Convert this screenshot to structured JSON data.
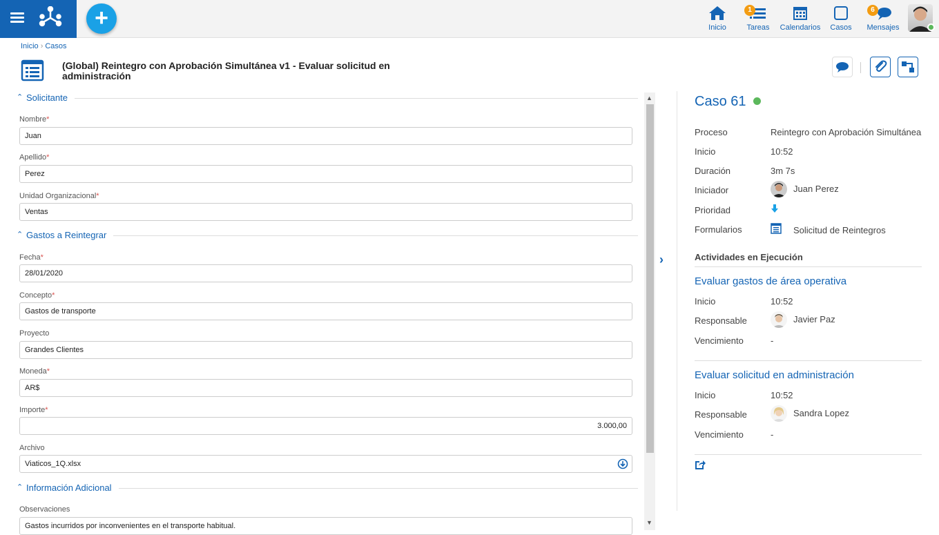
{
  "topbar": {
    "nav": [
      {
        "label": "Inicio",
        "icon": "home-icon"
      },
      {
        "label": "Tareas",
        "icon": "tasks-icon",
        "badge": "1"
      },
      {
        "label": "Calendarios",
        "icon": "calendar-icon"
      },
      {
        "label": "Casos",
        "icon": "cases-icon"
      },
      {
        "label": "Mensajes",
        "icon": "messages-icon",
        "badge": "6"
      }
    ],
    "add_label": "+",
    "colors": {
      "brand": "#1464b4",
      "accent": "#1aa1e6",
      "badge": "#f39c12",
      "online": "#5cb85c"
    }
  },
  "breadcrumb": {
    "home": "Inicio",
    "sep": "›",
    "current": "Casos"
  },
  "page_title": "(Global) Reintegro con Aprobación Simultánea v1 - Evaluar solicitud en administración",
  "form": {
    "sections": [
      {
        "title": "Solicitante"
      },
      {
        "title": "Gastos a Reintegrar"
      },
      {
        "title": "Información Adicional"
      }
    ],
    "fields": {
      "nombre": {
        "label": "Nombre",
        "required": "*",
        "value": "Juan"
      },
      "apellido": {
        "label": "Apellido",
        "required": "*",
        "value": "Perez"
      },
      "unidad": {
        "label": "Unidad Organizacional",
        "required": "*",
        "value": "Ventas"
      },
      "fecha": {
        "label": "Fecha",
        "required": "*",
        "value": "28/01/2020"
      },
      "concepto": {
        "label": "Concepto",
        "required": "*",
        "value": "Gastos de transporte"
      },
      "proyecto": {
        "label": "Proyecto",
        "value": "Grandes Clientes"
      },
      "moneda": {
        "label": "Moneda",
        "required": "*",
        "value": "AR$"
      },
      "importe": {
        "label": "Importe",
        "required": "*",
        "value": "3.000,00"
      },
      "archivo": {
        "label": "Archivo",
        "value": "Viaticos_1Q.xlsx"
      },
      "observaciones": {
        "label": "Observaciones",
        "value": "Gastos incurridos por inconvenientes en el transporte habitual."
      }
    }
  },
  "case": {
    "title": "Caso 61",
    "status_color": "#5cb85c",
    "rows": {
      "proceso": {
        "label": "Proceso",
        "value": "Reintegro con Aprobación Simultánea"
      },
      "inicio": {
        "label": "Inicio",
        "value": "10:52"
      },
      "duracion": {
        "label": "Duración",
        "value": "3m 7s"
      },
      "iniciador": {
        "label": "Iniciador",
        "value": "Juan Perez"
      },
      "prioridad": {
        "label": "Prioridad",
        "icon": "priority-low-icon"
      },
      "formularios": {
        "label": "Formularios",
        "value": "Solicitud de Reintegros"
      }
    },
    "activities_heading": "Actividades en Ejecución",
    "activities": [
      {
        "title": "Evaluar gastos de área operativa",
        "inicio_label": "Inicio",
        "inicio": "10:52",
        "resp_label": "Responsable",
        "responsable": "Javier Paz",
        "venc_label": "Vencimiento",
        "vencimiento": "-"
      },
      {
        "title": "Evaluar solicitud en administración",
        "inicio_label": "Inicio",
        "inicio": "10:52",
        "resp_label": "Responsable",
        "responsable": "Sandra Lopez",
        "venc_label": "Vencimiento",
        "vencimiento": "-"
      }
    ]
  }
}
